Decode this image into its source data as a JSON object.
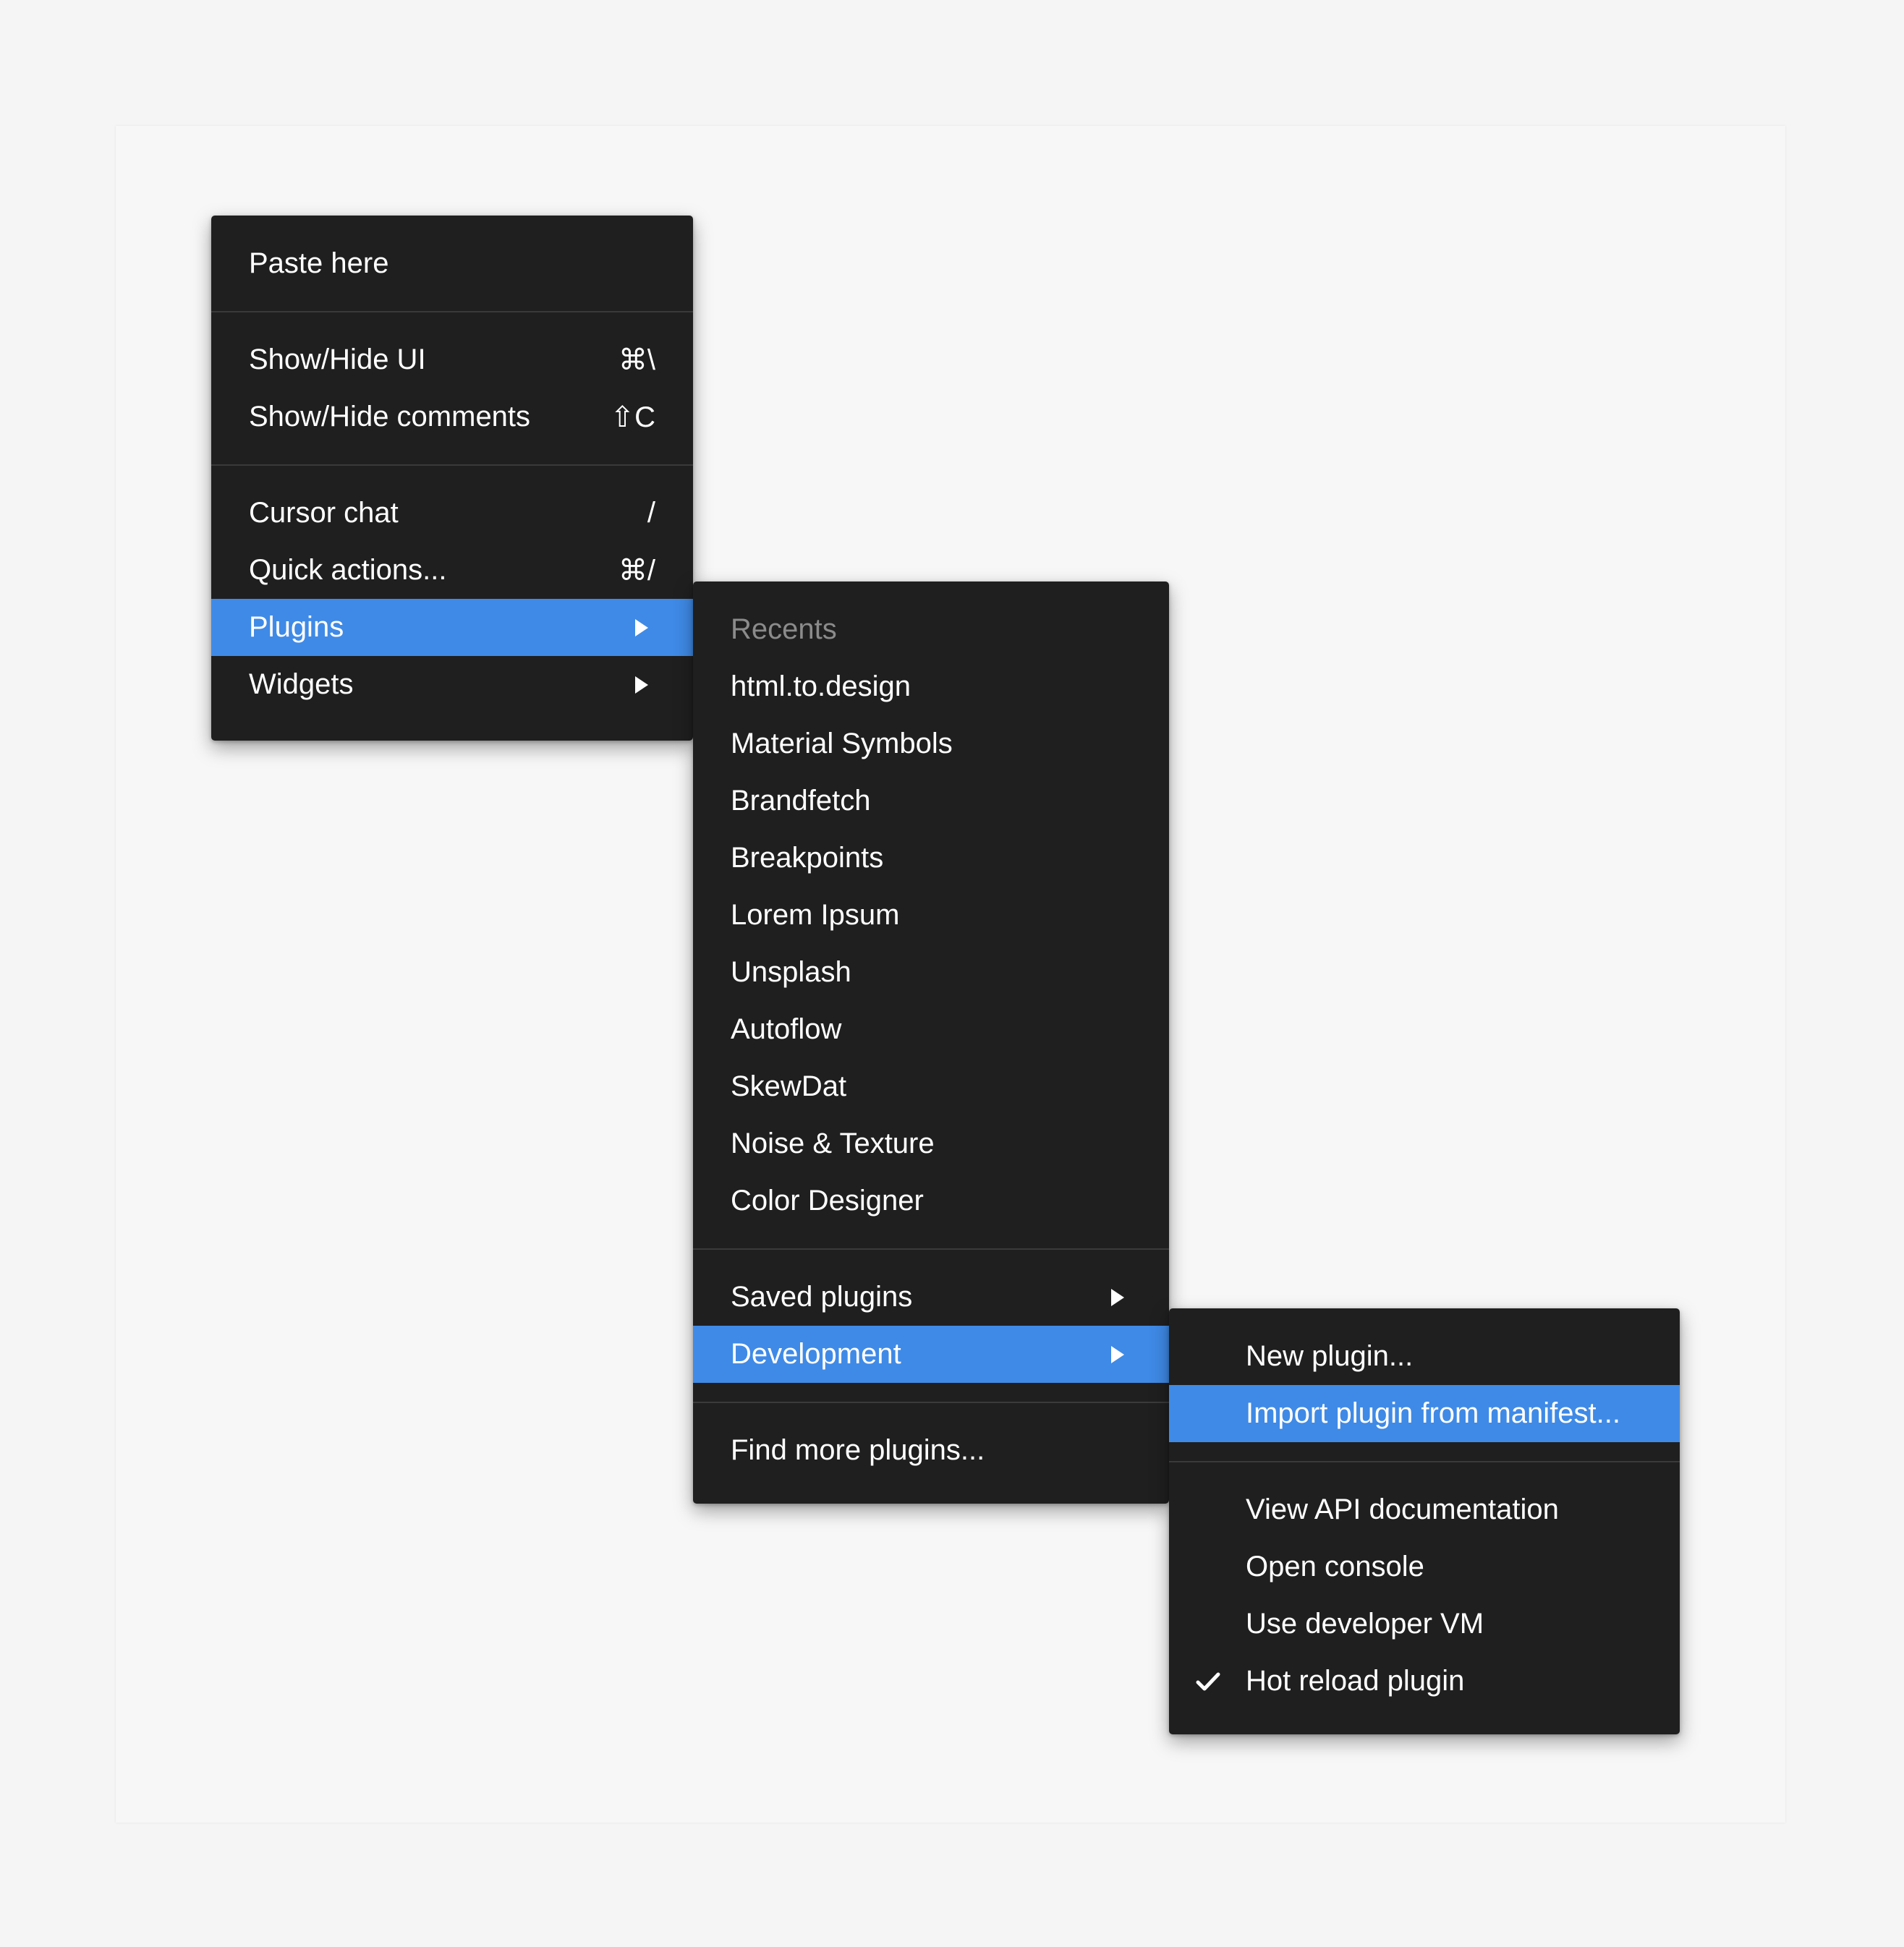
{
  "main_menu": {
    "paste_here": "Paste here",
    "show_hide_ui": {
      "label": "Show/Hide UI",
      "shortcut": "⌘\\"
    },
    "show_hide_comments": {
      "label": "Show/Hide comments",
      "shortcut": "⇧C"
    },
    "cursor_chat": {
      "label": "Cursor chat",
      "shortcut": "/"
    },
    "quick_actions": {
      "label": "Quick actions...",
      "shortcut": "⌘/"
    },
    "plugins": "Plugins",
    "widgets": "Widgets"
  },
  "plugins_menu": {
    "recents_heading": "Recents",
    "recents": [
      "html.to.design",
      "Material Symbols",
      "Brandfetch",
      "Breakpoints",
      "Lorem Ipsum",
      "Unsplash",
      "Autoflow",
      "SkewDat",
      "Noise & Texture",
      "Color Designer"
    ],
    "saved_plugins": "Saved plugins",
    "development": "Development",
    "find_more": "Find more plugins..."
  },
  "development_menu": {
    "new_plugin": "New plugin...",
    "import_manifest": "Import plugin from manifest...",
    "view_api_docs": "View API documentation",
    "open_console": "Open console",
    "use_developer_vm": "Use developer VM",
    "hot_reload": "Hot reload plugin",
    "hot_reload_checked": true
  },
  "colors": {
    "menu_bg": "#1f1f1f",
    "highlight": "#3f8ae6",
    "separator": "#3a3a3a",
    "muted_text": "#8b8b8b",
    "canvas": "#f7f7f7"
  },
  "icons": {
    "submenu": "chevron-right-icon",
    "check": "checkmark-icon"
  }
}
